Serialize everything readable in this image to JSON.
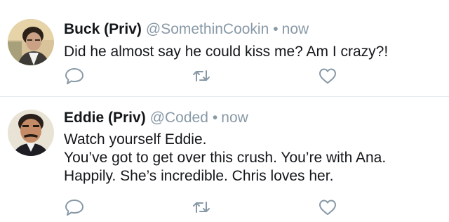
{
  "tweets": [
    {
      "display_name": "Buck (Priv)",
      "handle": "@SomethinCookin",
      "separator": "•",
      "time": "now",
      "lines": [
        "Did he almost say he could kiss me? Am I crazy?!"
      ],
      "avatar": "avatar-man-dark-hair"
    },
    {
      "display_name": "Eddie (Priv)",
      "handle": "@Coded",
      "separator": "•",
      "time": "now",
      "lines": [
        "Watch yourself Eddie.",
        "You’ve got to get over this crush. You’re with Ana.",
        "Happily. She’s incredible. Chris loves her."
      ],
      "avatar": "avatar-man-mustache"
    }
  ],
  "icons": {
    "reply": "reply-icon",
    "retweet": "retweet-icon",
    "like": "heart-icon"
  },
  "colors": {
    "text": "#14171a",
    "secondary": "#8899a6",
    "icon": "#8899a6",
    "divider": "#e1e8ed"
  }
}
